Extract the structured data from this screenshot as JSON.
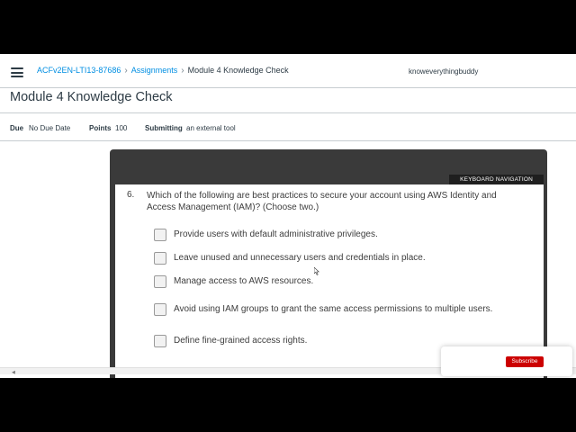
{
  "nav": {
    "breadcrumb": [
      "ACFv2EN-LTI13-87686",
      "Assignments",
      "Module 4 Knowledge Check"
    ]
  },
  "page_title": "Module 4 Knowledge Check",
  "meta": {
    "due_label": "Due",
    "due_value": "No Due Date",
    "points_label": "Points",
    "points_value": "100",
    "submitting_label": "Submitting",
    "submitting_value": "an external tool",
    "username": "knoweverythingbuddy"
  },
  "quiz": {
    "keyboard_nav_label": "KEYBOARD NAVIGATION",
    "question_number": "6.",
    "question_text": "Which of the following are best practices to secure your account using AWS Identity and Access Management (IAM)? (Choose two.)",
    "options": [
      {
        "label": "Provide users with default administrative privileges.",
        "checked": false
      },
      {
        "label": "Leave unused and unnecessary users and credentials in place.",
        "checked": false
      },
      {
        "label": "Manage access to AWS resources.",
        "checked": false
      },
      {
        "label": "Avoid using IAM groups to grant the same access permissions to multiple users.",
        "checked": false
      },
      {
        "label": "Define fine-grained access rights.",
        "checked": false
      }
    ]
  },
  "overlay": {
    "subscribe_label": "Subscribe",
    "subscribe_color": "#cc0000"
  },
  "colors": {
    "link": "#008ee2",
    "text": "#2d3b45",
    "quiz_frame": "#3a3a3a"
  }
}
